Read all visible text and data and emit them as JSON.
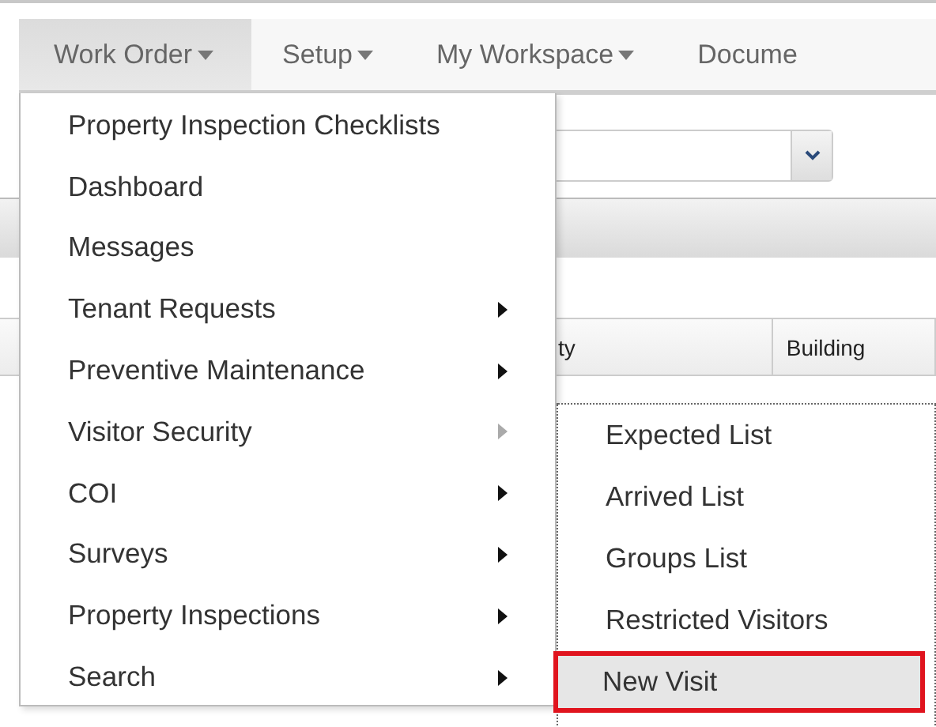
{
  "nav": [
    {
      "label": "Work Order",
      "caret": true,
      "selected": true
    },
    {
      "label": "Setup",
      "caret": true,
      "selected": false
    },
    {
      "label": "My Workspace",
      "caret": true,
      "selected": false
    },
    {
      "label": "Docume",
      "caret": false,
      "selected": false
    }
  ],
  "table": {
    "columns": [
      "ty",
      "Building"
    ]
  },
  "menu": {
    "items": [
      {
        "label": "Property Inspection Checklists",
        "has_submenu": false
      },
      {
        "label": "Dashboard",
        "has_submenu": false
      },
      {
        "label": "Messages",
        "has_submenu": false
      },
      {
        "label": "Tenant Requests",
        "has_submenu": true,
        "expanded": false
      },
      {
        "label": "Preventive Maintenance",
        "has_submenu": true,
        "expanded": false
      },
      {
        "label": "Visitor Security",
        "has_submenu": true,
        "expanded": true
      },
      {
        "label": "COI",
        "has_submenu": true,
        "expanded": false
      },
      {
        "label": "Surveys",
        "has_submenu": true,
        "expanded": false
      },
      {
        "label": "Property Inspections",
        "has_submenu": true,
        "expanded": false
      },
      {
        "label": "Search",
        "has_submenu": true,
        "expanded": false
      }
    ]
  },
  "submenu": {
    "items": [
      {
        "label": "Expected List",
        "selected": false
      },
      {
        "label": "Arrived List",
        "selected": false
      },
      {
        "label": "Groups List",
        "selected": false
      },
      {
        "label": "Restricted Visitors",
        "selected": false
      },
      {
        "label": "New Visit",
        "selected": true
      }
    ]
  }
}
